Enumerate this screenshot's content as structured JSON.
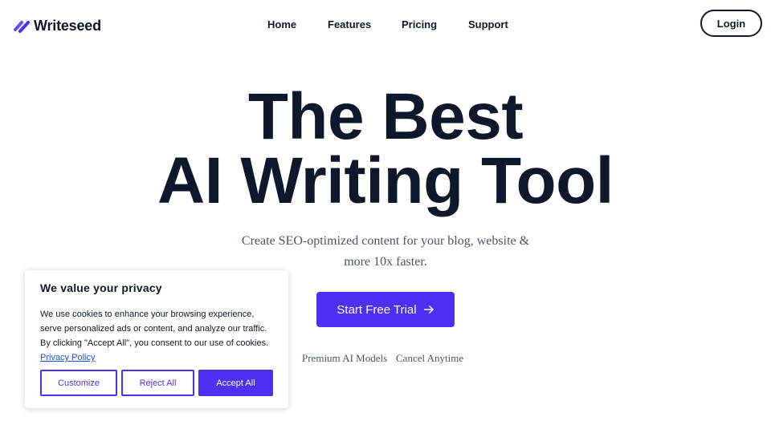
{
  "brand": {
    "name": "Writeseed",
    "logo_icon": "slash-stripes-icon",
    "accent": "#4f2ff2"
  },
  "nav": {
    "items": [
      "Home",
      "Features",
      "Pricing",
      "Support"
    ],
    "login_label": "Login"
  },
  "hero": {
    "title_line1": "The Best",
    "title_line2": "AI Writing Tool",
    "subtitle": "Create SEO-optimized content for your blog, website & more 10x faster.",
    "cta_label": "Start Free Trial",
    "cta_icon": "arrow-right-icon",
    "features": [
      "Premium AI Models",
      "Cancel Anytime"
    ]
  },
  "cookie": {
    "title": "We value your privacy",
    "text": "We use cookies to enhance your browsing experience, serve personalized ads or content, and analyze our traffic. By clicking \"Accept All\", you consent to our use of cookies.",
    "policy_link": "Privacy Policy",
    "customize_label": "Customize",
    "reject_label": "Reject All",
    "accept_label": "Accept All"
  }
}
